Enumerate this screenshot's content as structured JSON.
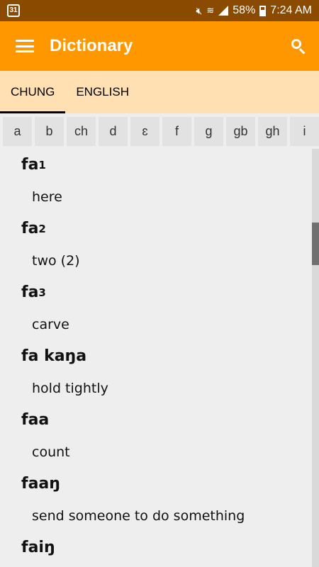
{
  "status_bar": {
    "calendar_day": "31",
    "battery_percent": "58%",
    "time": "7:24 AM",
    "icons": [
      "calendar-icon",
      "mute-icon",
      "wifi-icon",
      "signal-icon",
      "battery-icon"
    ]
  },
  "app_bar": {
    "title": "Dictionary",
    "background": "#ff9800",
    "icons": [
      "menu-icon",
      "search-icon"
    ]
  },
  "tabs": [
    {
      "label": "CHUNG",
      "active": true
    },
    {
      "label": "ENGLISH",
      "active": false
    }
  ],
  "letters": [
    "a",
    "b",
    "ch",
    "d",
    "ɛ",
    "f",
    "g",
    "gb",
    "gh",
    "i"
  ],
  "entries": [
    {
      "word": "fa",
      "sub": "1",
      "definition": "here"
    },
    {
      "word": "fa",
      "sub": "2",
      "definition": "two (2)"
    },
    {
      "word": "fa",
      "sub": "3",
      "definition": "carve"
    },
    {
      "word": "fa kaŋa",
      "sub": "",
      "definition": "hold tightly"
    },
    {
      "word": "faa",
      "sub": "",
      "definition": "count"
    },
    {
      "word": "faaŋ",
      "sub": "",
      "definition": "send someone to do something"
    },
    {
      "word": "faiŋ",
      "sub": "",
      "definition": ""
    }
  ]
}
